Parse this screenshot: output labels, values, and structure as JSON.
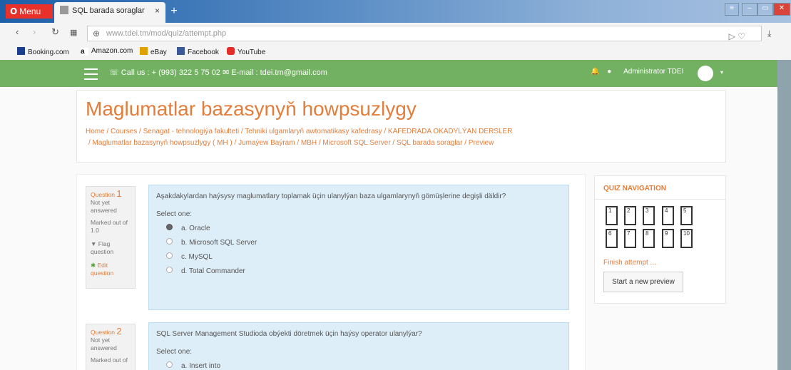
{
  "browser": {
    "menu_label": "Menu",
    "tab_title": "SQL barada soraglar",
    "tab_close": "×",
    "new_tab": "+",
    "url": "www.tdei.tm/mod/quiz/attempt.php",
    "bookmarks": [
      {
        "label": "Booking.com",
        "color": "#1b3f8f"
      },
      {
        "label": "Amazon.com",
        "color": "#111111"
      },
      {
        "label": "eBay",
        "color": "#e0a000"
      },
      {
        "label": "Facebook",
        "color": "#3b5998"
      },
      {
        "label": "YouTube",
        "color": "#e52d27"
      }
    ]
  },
  "navbar": {
    "contact": "☏ Call us : + (993) 322 5 75 02  ✉ E-mail : tdei.tm@gmail.com",
    "user_name": "Administrator TDEI"
  },
  "header": {
    "title": "Maglumatlar bazasynyň howpsuzlygy",
    "breadcrumb_line1": "Home / Courses / Senagat - tehnologiýa fakulteti / Tehniki ulgamlaryň awtomatikasy kafedrasy / KAFEDRADA OKADYLÝAN DERSLER",
    "breadcrumb_line2": "/ Maglumatlar bazasynyň howpsuzlygy ( MH ) / Jumaýew Baýram / MBH / Microsoft SQL Server / SQL barada soraglar / Preview"
  },
  "questions": [
    {
      "label": "Question",
      "number": "1",
      "status_line1": "Not yet",
      "status_line2": "answered",
      "marked_line1": "Marked out of",
      "marked_line2": "1.0",
      "flag_line1": "Flag",
      "flag_line2": "question",
      "edit_line1": "Edit",
      "edit_line2": "question",
      "text": "Aşakdakylardan haýsysy maglumatlary toplamak üçin ulanylýan baza ulgamlarynyň gömüşlerine degişli däldir?",
      "select_label": "Select one:",
      "options": [
        "a. Oracle",
        "b. Microsoft SQL Server",
        "c. MySQL",
        "d. Total Commander"
      ],
      "selected_index": 0
    },
    {
      "label": "Question",
      "number": "2",
      "status_line1": "Not yet",
      "status_line2": "answered",
      "marked_line1": "Marked out of",
      "text": "SQL Server Management Studioda obýekti döretmek üçin haýsy operator ulanylýar?",
      "select_label": "Select one:",
      "options": [
        "a. Insert into"
      ]
    }
  ],
  "quiz_navigation": {
    "title": "QUIZ NAVIGATION",
    "buttons": [
      "1",
      "2",
      "3",
      "4",
      "5",
      "6",
      "7",
      "8",
      "9",
      "10"
    ],
    "finish_label": "Finish attempt ...",
    "start_preview_label": "Start a new preview"
  }
}
